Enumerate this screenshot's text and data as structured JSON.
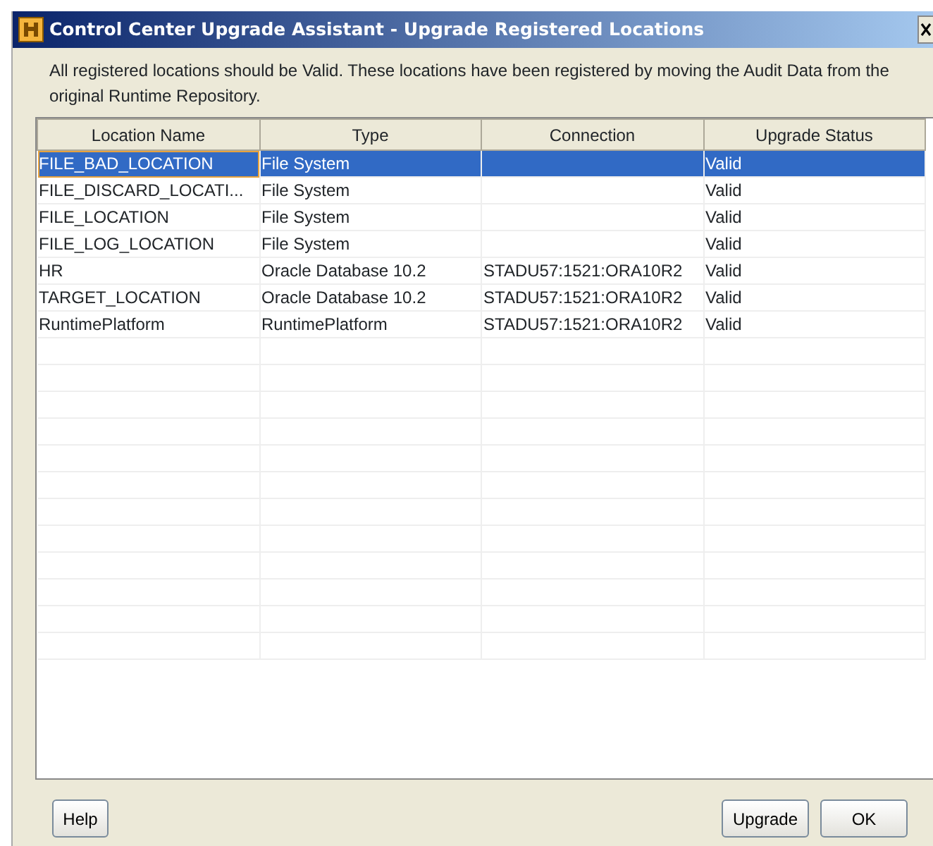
{
  "window": {
    "title": "Control Center Upgrade Assistant - Upgrade Registered Locations"
  },
  "message": "All registered locations should be Valid. These locations have been registered by moving the Audit Data from the original Runtime Repository.",
  "table": {
    "columns": [
      "Location Name",
      "Type",
      "Connection",
      "Upgrade Status"
    ],
    "rows": [
      {
        "cells": [
          "FILE_BAD_LOCATION",
          "File System",
          "",
          "Valid"
        ],
        "selected": true
      },
      {
        "cells": [
          "FILE_DISCARD_LOCATI...",
          "File System",
          "",
          "Valid"
        ],
        "selected": false
      },
      {
        "cells": [
          "FILE_LOCATION",
          "File System",
          "",
          "Valid"
        ],
        "selected": false
      },
      {
        "cells": [
          "FILE_LOG_LOCATION",
          "File System",
          "",
          "Valid"
        ],
        "selected": false
      },
      {
        "cells": [
          "HR",
          "Oracle Database 10.2",
          "STADU57:1521:ORA10R2",
          "Valid"
        ],
        "selected": false
      },
      {
        "cells": [
          "TARGET_LOCATION",
          "Oracle Database 10.2",
          "STADU57:1521:ORA10R2",
          "Valid"
        ],
        "selected": false
      },
      {
        "cells": [
          "RuntimePlatform",
          "RuntimePlatform",
          "STADU57:1521:ORA10R2",
          "Valid"
        ],
        "selected": false
      }
    ]
  },
  "buttons_left": [
    "Help"
  ],
  "buttons_right": [
    "Upgrade",
    "OK"
  ]
}
